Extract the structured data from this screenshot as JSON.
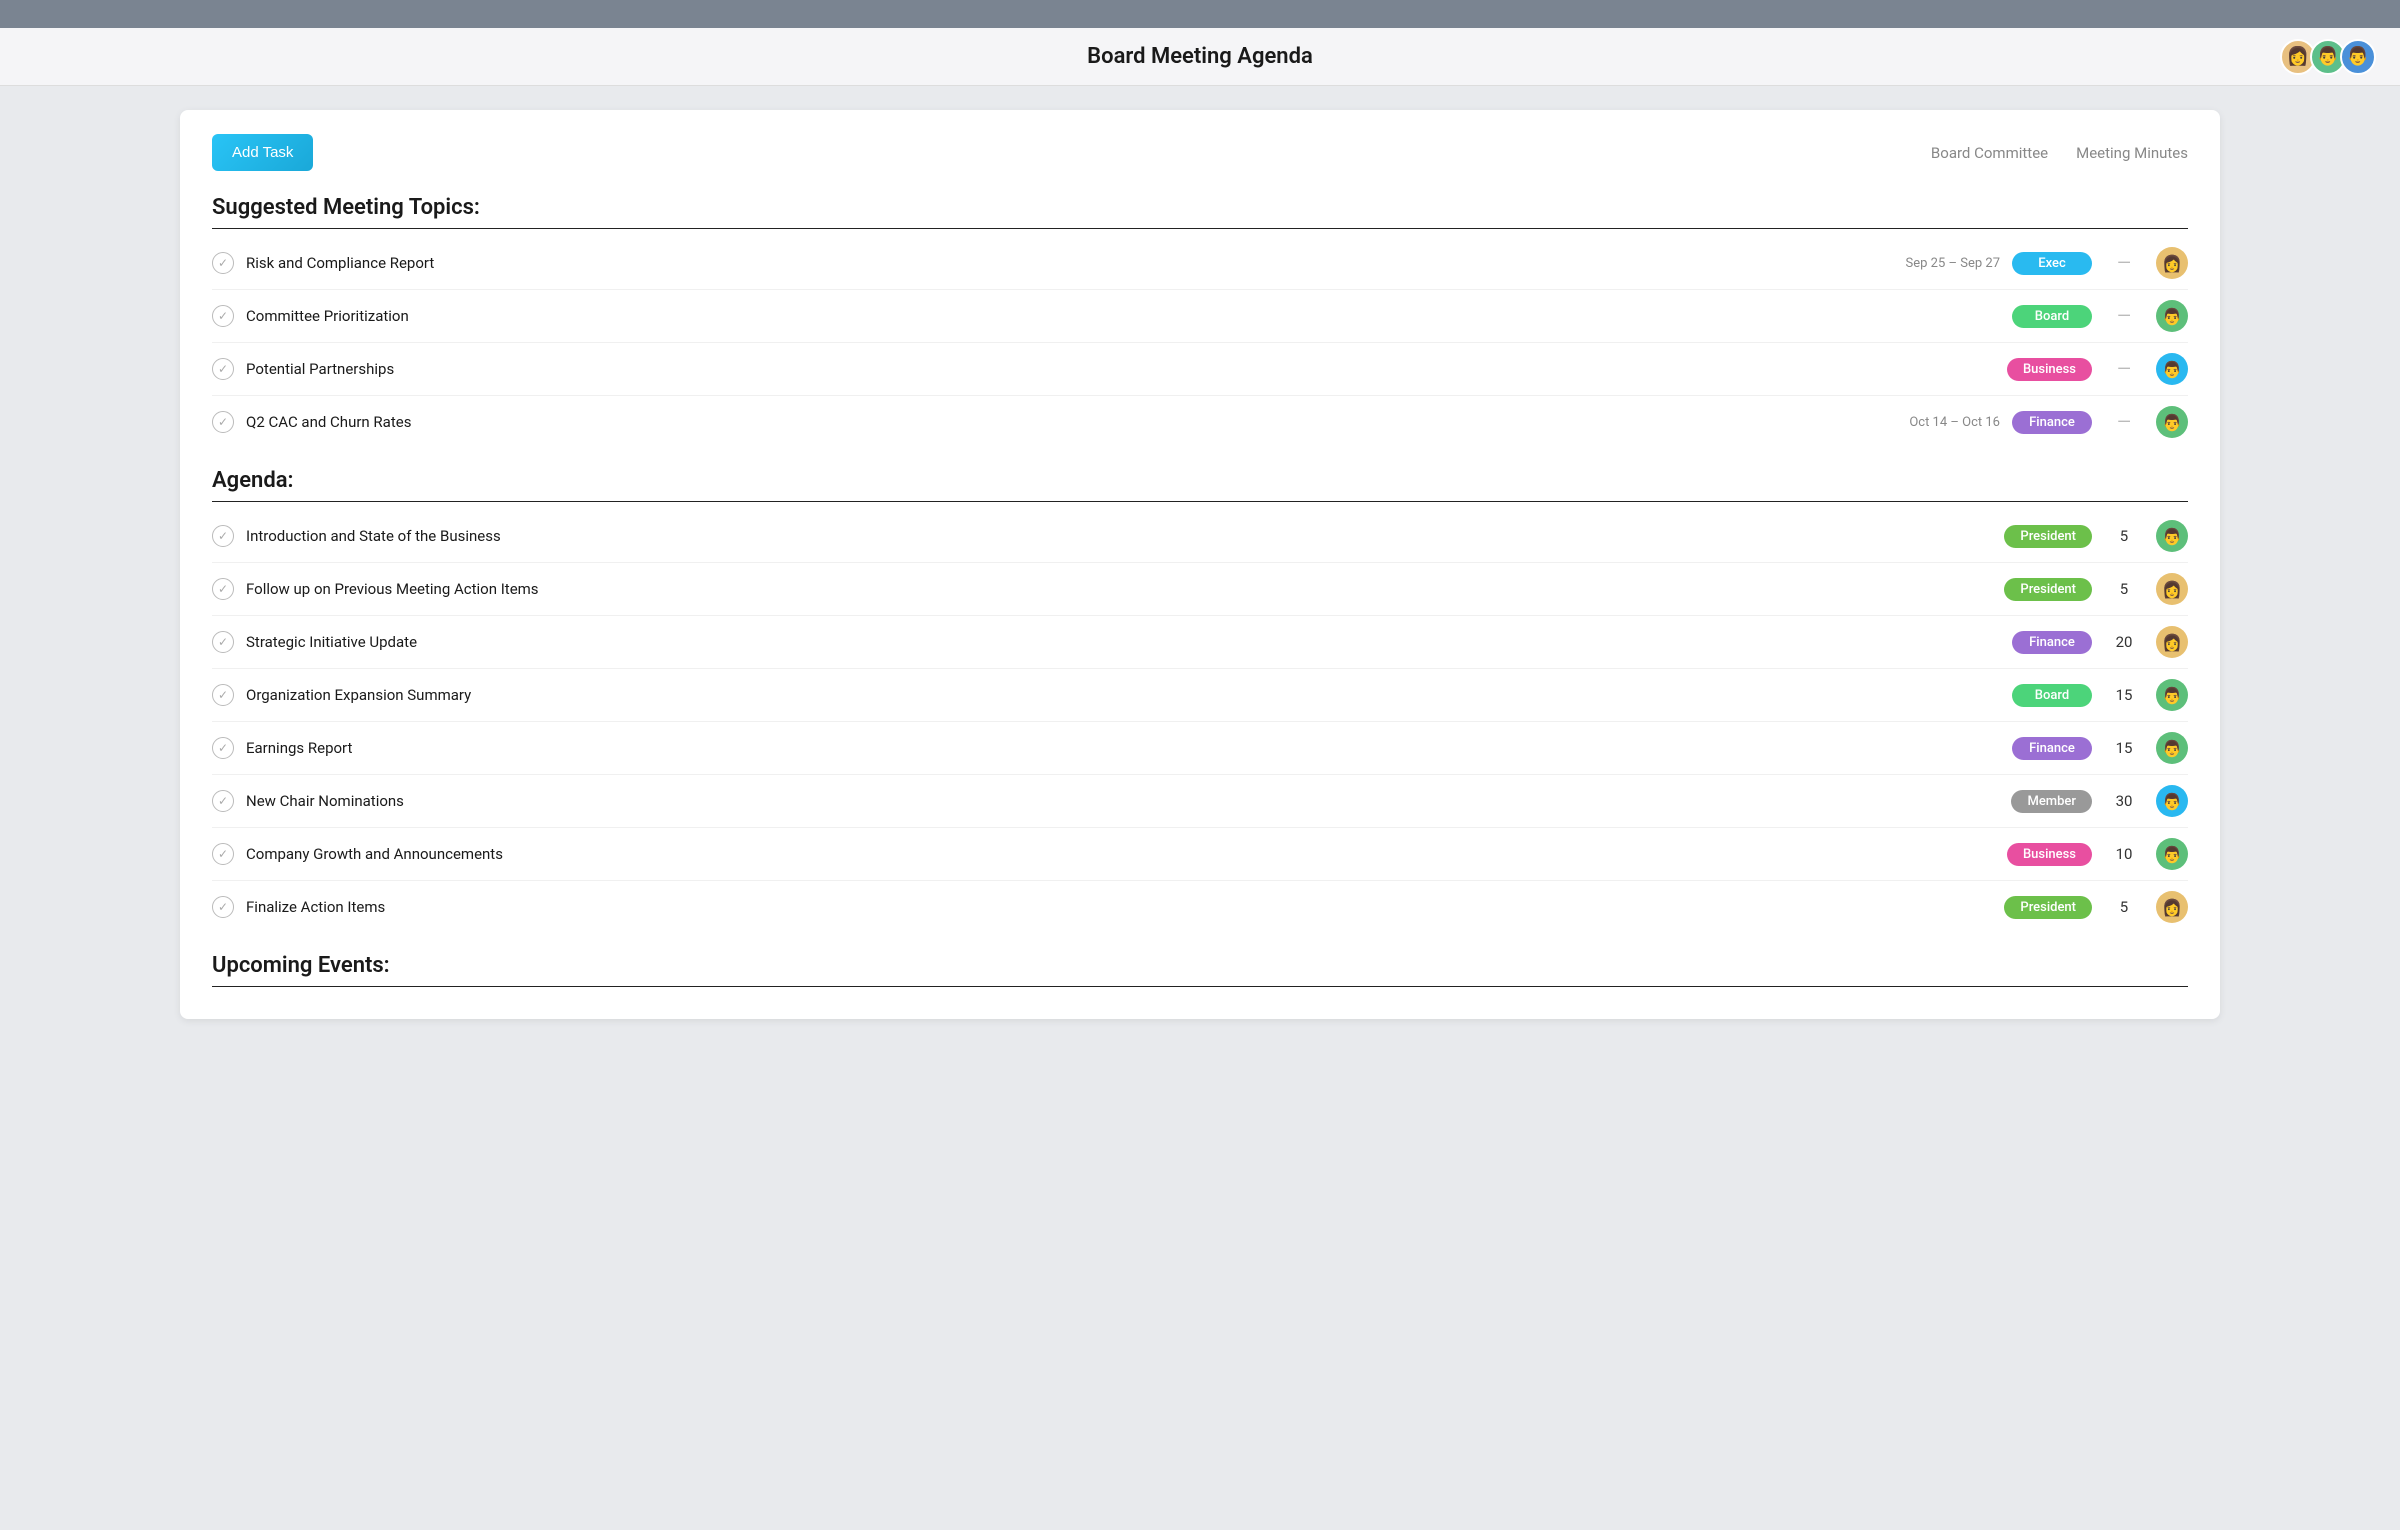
{
  "topbar": {},
  "header": {
    "title": "Board Meeting Agenda",
    "avatars": [
      {
        "class": "av1",
        "emoji": "👩"
      },
      {
        "class": "av2",
        "emoji": "👨"
      },
      {
        "class": "av3",
        "emoji": "👨"
      }
    ]
  },
  "toolbar": {
    "add_task_label": "Add Task",
    "links": [
      {
        "label": "Board Committee"
      },
      {
        "label": "Meeting Minutes"
      }
    ]
  },
  "sections": [
    {
      "id": "suggested",
      "title": "Suggested Meeting Topics:",
      "tasks": [
        {
          "label": "Risk and Compliance Report",
          "date": "Sep 25 – Sep 27",
          "tag": "Exec",
          "tag_class": "tag-exec",
          "minutes": "",
          "has_dash": true,
          "avatar_class": "ta1",
          "avatar_emoji": "👩"
        },
        {
          "label": "Committee Prioritization",
          "date": "",
          "tag": "Board",
          "tag_class": "tag-board",
          "minutes": "",
          "has_dash": true,
          "avatar_class": "ta2",
          "avatar_emoji": "👨"
        },
        {
          "label": "Potential Partnerships",
          "date": "",
          "tag": "Business",
          "tag_class": "tag-business",
          "minutes": "",
          "has_dash": true,
          "avatar_class": "ta3",
          "avatar_emoji": "👨"
        },
        {
          "label": "Q2 CAC and Churn Rates",
          "date": "Oct 14 – Oct 16",
          "tag": "Finance",
          "tag_class": "tag-finance",
          "minutes": "",
          "has_dash": true,
          "avatar_class": "ta4",
          "avatar_emoji": "👨"
        }
      ]
    },
    {
      "id": "agenda",
      "title": "Agenda:",
      "tasks": [
        {
          "label": "Introduction and State of the Business",
          "date": "",
          "tag": "President",
          "tag_class": "tag-president",
          "minutes": "5",
          "has_dash": false,
          "avatar_class": "ta5",
          "avatar_emoji": "👨"
        },
        {
          "label": "Follow up on Previous Meeting Action Items",
          "date": "",
          "tag": "President",
          "tag_class": "tag-president",
          "minutes": "5",
          "has_dash": false,
          "avatar_class": "ta6",
          "avatar_emoji": "👩"
        },
        {
          "label": "Strategic Initiative Update",
          "date": "",
          "tag": "Finance",
          "tag_class": "tag-finance",
          "minutes": "20",
          "has_dash": false,
          "avatar_class": "ta7",
          "avatar_emoji": "👩"
        },
        {
          "label": "Organization Expansion Summary",
          "date": "",
          "tag": "Board",
          "tag_class": "tag-board",
          "minutes": "15",
          "has_dash": false,
          "avatar_class": "ta8",
          "avatar_emoji": "👨"
        },
        {
          "label": "Earnings Report",
          "date": "",
          "tag": "Finance",
          "tag_class": "tag-finance",
          "minutes": "15",
          "has_dash": false,
          "avatar_class": "ta9",
          "avatar_emoji": "👨"
        },
        {
          "label": "New Chair Nominations",
          "date": "",
          "tag": "Member",
          "tag_class": "tag-member",
          "minutes": "30",
          "has_dash": false,
          "avatar_class": "ta10",
          "avatar_emoji": "👨"
        },
        {
          "label": "Company Growth and Announcements",
          "date": "",
          "tag": "Business",
          "tag_class": "tag-business",
          "minutes": "10",
          "has_dash": false,
          "avatar_class": "ta11",
          "avatar_emoji": "👨"
        },
        {
          "label": "Finalize Action Items",
          "date": "",
          "tag": "President",
          "tag_class": "tag-president",
          "minutes": "5",
          "has_dash": false,
          "avatar_class": "ta12",
          "avatar_emoji": "👩"
        }
      ]
    },
    {
      "id": "upcoming",
      "title": "Upcoming Events:",
      "tasks": []
    }
  ]
}
